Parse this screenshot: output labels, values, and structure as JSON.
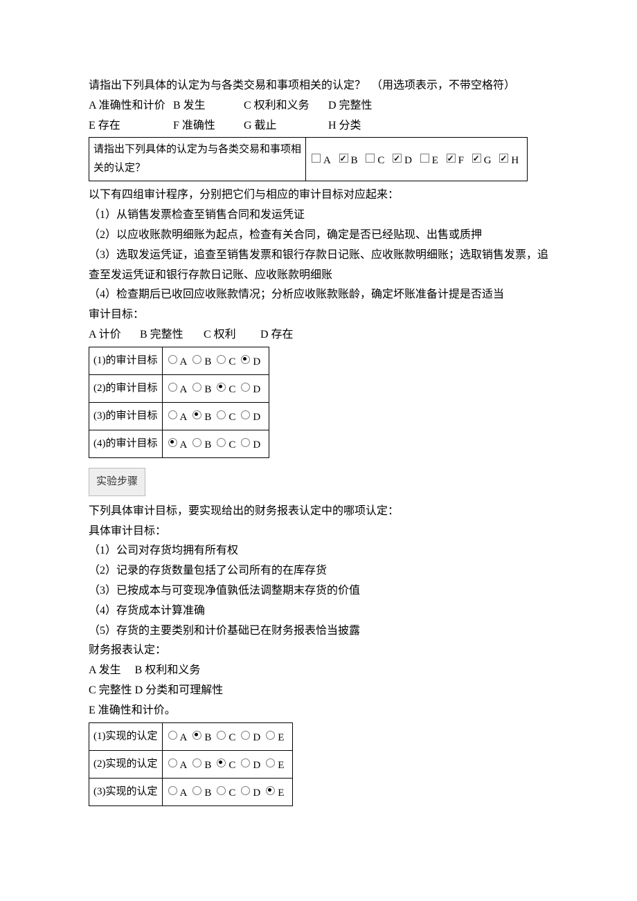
{
  "q1": {
    "prompt": "请指出下列具体的认定为与各类交易和事项相关的认定？　（用选项表示，不带空格符）",
    "optsLine1": {
      "A": "A 准确性和计价",
      "B": "B 发生",
      "C": "C 权利和义务",
      "D": "D 完整性"
    },
    "optsLine2": {
      "E": "E 存在",
      "F": "F 准确性",
      "G": "G 截止",
      "H": "H 分类"
    },
    "tableLabel": "请指出下列具体的认定为与各类交易和事项相关的认定？",
    "letters": [
      "A",
      "B",
      "C",
      "D",
      "E",
      "F",
      "G",
      "H"
    ]
  },
  "q2": {
    "intro": "以下有四组审计程序，分别把它们与相应的审计目标对应起来：",
    "items": [
      "（1）从销售发票检查至销售合同和发运凭证",
      "（2）以应收账款明细账为起点，检查有关合同，确定是否已经贴现、出售或质押",
      "（3）选取发运凭证，追查至销售发票和银行存款日记账、应收账款明细账；选取销售发票，追查至发运凭证和银行存款日记账、应收账款明细账",
      "（4）检查期后已收回应收账款情况；分析应收账款账龄，确定坏账准备计提是否适当"
    ],
    "targetsLabel": "审计目标：",
    "opts": {
      "A": "A 计价",
      "B": "B 完整性",
      "C": "C 权利",
      "D": "D 存在"
    },
    "rows": [
      {
        "label": "(1)的审计目标",
        "selected": "D"
      },
      {
        "label": "(2)的审计目标",
        "selected": "C"
      },
      {
        "label": "(3)的审计目标",
        "selected": "B"
      },
      {
        "label": "(4)的审计目标",
        "selected": "A"
      }
    ],
    "letters": [
      "A",
      "B",
      "C",
      "D"
    ]
  },
  "button": "实验步骤",
  "q3": {
    "intro": "下列具体审计目标，要实现给出的财务报表认定中的哪项认定：",
    "sub1": "具体审计目标：",
    "items": [
      "（1）公司对存货均拥有所有权",
      "（2）记录的存货数量包括了公司所有的在库存货",
      "（3）已按成本与可变现净值孰低法调整期末存货的价值",
      "（4）存货成本计算准确",
      "（5）存货的主要类别和计价基础已在财务报表恰当披露"
    ],
    "sub2": "财务报表认定：",
    "optsLine1": "A 发生　 B 权利和义务",
    "optsLine2": "C 完整性 D 分类和可理解性",
    "optsLine3": "E 准确性和计价。",
    "rows": [
      {
        "label": "(1)实现的认定",
        "selected": "B"
      },
      {
        "label": "(2)实现的认定",
        "selected": "C"
      },
      {
        "label": "(3)实现的认定",
        "selected": "E"
      }
    ],
    "letters": [
      "A",
      "B",
      "C",
      "D",
      "E"
    ]
  }
}
